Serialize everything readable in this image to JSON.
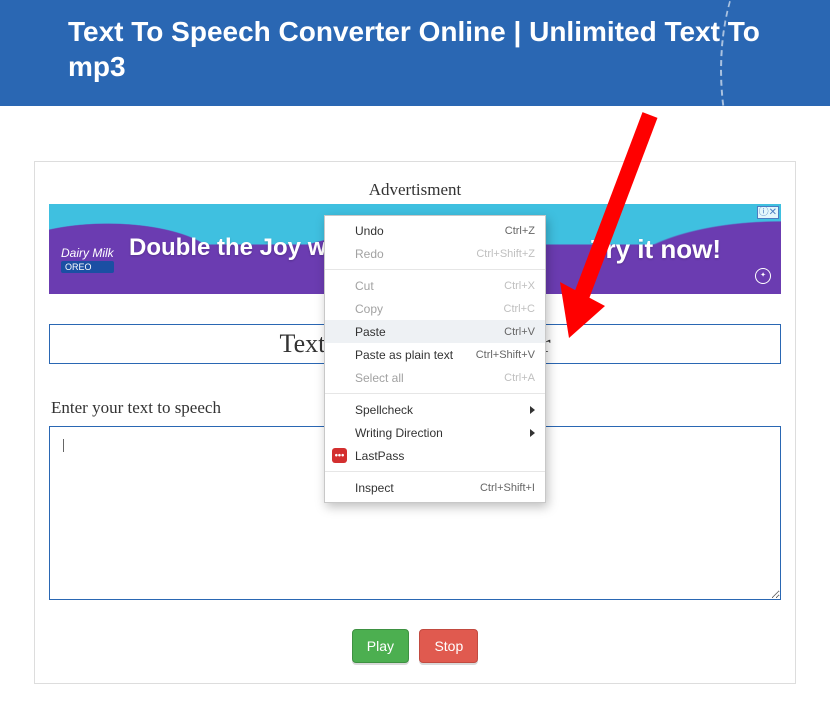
{
  "header": {
    "title": "Text To Speech Converter Online | Unlimited Text To mp3"
  },
  "ad": {
    "section_label": "Advertisment",
    "left_text": "Double the Joy w",
    "right_text": "Try it now!",
    "brand_line1": "Dairy Milk",
    "brand_line2": "OREO",
    "badge": "ⓘ✕"
  },
  "tool": {
    "title": "Text To Speech Converter",
    "label": "Enter your text to speech",
    "textarea_initial": "|",
    "play": "Play",
    "stop": "Stop"
  },
  "context_menu": {
    "items": [
      {
        "label": "Undo",
        "shortcut": "Ctrl+Z",
        "state": "enabled",
        "sep_after": false
      },
      {
        "label": "Redo",
        "shortcut": "Ctrl+Shift+Z",
        "state": "disabled",
        "sep_after": true
      },
      {
        "label": "Cut",
        "shortcut": "Ctrl+X",
        "state": "disabled",
        "sep_after": false
      },
      {
        "label": "Copy",
        "shortcut": "Ctrl+C",
        "state": "disabled",
        "sep_after": false
      },
      {
        "label": "Paste",
        "shortcut": "Ctrl+V",
        "state": "highlight",
        "sep_after": false
      },
      {
        "label": "Paste as plain text",
        "shortcut": "Ctrl+Shift+V",
        "state": "enabled",
        "sep_after": false
      },
      {
        "label": "Select all",
        "shortcut": "Ctrl+A",
        "state": "disabled",
        "sep_after": true
      },
      {
        "label": "Spellcheck",
        "shortcut": "",
        "state": "enabled",
        "submenu": true,
        "sep_after": false
      },
      {
        "label": "Writing Direction",
        "shortcut": "",
        "state": "enabled",
        "submenu": true,
        "sep_after": false
      },
      {
        "label": "LastPass",
        "shortcut": "",
        "state": "enabled",
        "icon": "lp",
        "sep_after": true
      },
      {
        "label": "Inspect",
        "shortcut": "Ctrl+Shift+I",
        "state": "enabled",
        "sep_after": false
      }
    ]
  }
}
